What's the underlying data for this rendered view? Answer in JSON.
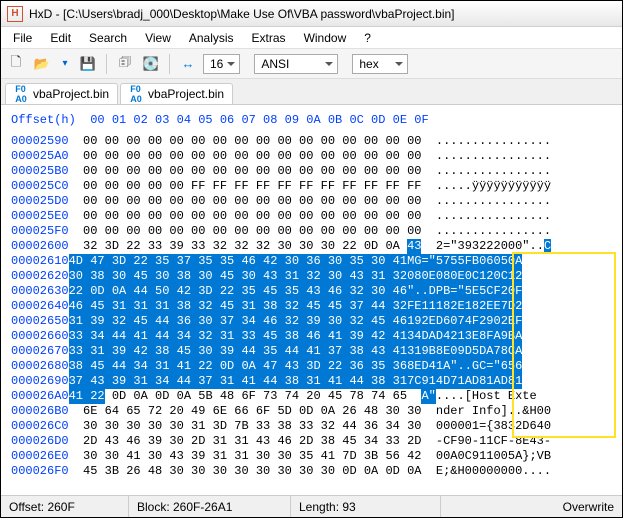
{
  "title": "HxD - [C:\\Users\\bradj_000\\Desktop\\Make Use Of\\VBA password\\vbaProject.bin]",
  "menu": {
    "file": "File",
    "edit": "Edit",
    "search": "Search",
    "view": "View",
    "analysis": "Analysis",
    "extras": "Extras",
    "window": "Window",
    "help": "?"
  },
  "toolbar": {
    "bytes_per_row": "16",
    "encoding": "ANSI",
    "base": "hex"
  },
  "tabs": {
    "tab1": "vbaProject.bin",
    "tab2": "vbaProject.bin"
  },
  "header_label": "Offset(h)",
  "header_cols": "00 01 02 03 04 05 06 07 08 09 0A 0B 0C 0D 0E 0F",
  "rows": [
    {
      "off": "00002590",
      "hex": "00 00 00 00 00 00 00 00 00 00 00 00 00 00 00 00",
      "asc": "................"
    },
    {
      "off": "000025A0",
      "hex": "00 00 00 00 00 00 00 00 00 00 00 00 00 00 00 00",
      "asc": "................"
    },
    {
      "off": "000025B0",
      "hex": "00 00 00 00 00 00 00 00 00 00 00 00 00 00 00 00",
      "asc": "................"
    },
    {
      "off": "000025C0",
      "hex": "00 00 00 00 00 FF FF FF FF FF FF FF FF FF FF FF",
      "asc": ".....ÿÿÿÿÿÿÿÿÿÿÿ"
    },
    {
      "off": "000025D0",
      "hex": "00 00 00 00 00 00 00 00 00 00 00 00 00 00 00 00",
      "asc": "................"
    },
    {
      "off": "000025E0",
      "hex": "00 00 00 00 00 00 00 00 00 00 00 00 00 00 00 00",
      "asc": "................"
    },
    {
      "off": "000025F0",
      "hex": "00 00 00 00 00 00 00 00 00 00 00 00 00 00 00 00",
      "asc": "................"
    },
    {
      "off": "00002600",
      "hex": "32 3D 22 33 39 33 32 32 32 30 30 30 22 0D 0A ",
      "asc": "2=\"393222000\"..",
      "hexsel": "43",
      "ascsel": "C"
    },
    {
      "off": "00002610",
      "hex": "",
      "asc": "",
      "hexsel": "4D 47 3D 22 35 37 35 35 46 42 30 36 30 35 30 41",
      "ascsel": "MG=\"5755FB06050A"
    },
    {
      "off": "00002620",
      "hex": "",
      "asc": "",
      "hexsel": "30 38 30 45 30 38 30 45 30 43 31 32 30 43 31 32",
      "ascsel": "080E080E0C120C12"
    },
    {
      "off": "00002630",
      "hex": "",
      "asc": "",
      "hexsel": "22 0D 0A 44 50 42 3D 22 35 45 35 43 46 32 30 46",
      "ascsel": "\"..DPB=\"5E5CF20F"
    },
    {
      "off": "00002640",
      "hex": "",
      "asc": "",
      "hexsel": "46 45 31 31 31 38 32 45 31 38 32 45 45 37 44 32",
      "ascsel": "FE11182E182EE7D2"
    },
    {
      "off": "00002650",
      "hex": "",
      "asc": "",
      "hexsel": "31 39 32 45 44 36 30 37 34 46 32 39 30 32 45 46",
      "ascsel": "192ED6074F2902EF"
    },
    {
      "off": "00002660",
      "hex": "",
      "asc": "",
      "hexsel": "33 34 44 41 44 34 32 31 33 45 38 46 41 39 42 41",
      "ascsel": "34DAD4213E8FA9BA"
    },
    {
      "off": "00002670",
      "hex": "",
      "asc": "",
      "hexsel": "33 31 39 42 38 45 30 39 44 35 44 41 37 38 43 41",
      "ascsel": "319B8E09D5DA78CA"
    },
    {
      "off": "00002680",
      "hex": "",
      "asc": "",
      "hexsel": "38 45 44 34 31 41 22 0D 0A 47 43 3D 22 36 35 36",
      "ascsel": "8ED41A\"..GC=\"656"
    },
    {
      "off": "00002690",
      "hex": "",
      "asc": "",
      "hexsel": "37 43 39 31 34 44 37 31 41 44 38 31 41 44 38 31",
      "ascsel": "7C914D71AD81AD81"
    },
    {
      "off": "000026A0",
      "hexsel": "41 22",
      "hex": " 0D 0A 0D 0A 5B 48 6F 73 74 20 45 78 74 65",
      "ascsel": "A\"",
      "asc": "....[Host Exte"
    },
    {
      "off": "000026B0",
      "hex": "6E 64 65 72 20 49 6E 66 6F 5D 0D 0A 26 48 30 30",
      "asc": "nder Info]..&H00"
    },
    {
      "off": "000026C0",
      "hex": "30 30 30 30 30 31 3D 7B 33 38 33 32 44 36 34 30",
      "asc": "000001={3832D640"
    },
    {
      "off": "000026D0",
      "hex": "2D 43 46 39 30 2D 31 31 43 46 2D 38 45 34 33 2D",
      "asc": "-CF90-11CF-8E43-"
    },
    {
      "off": "000026E0",
      "hex": "30 30 41 30 43 39 31 31 30 30 35 41 7D 3B 56 42",
      "asc": "00A0C911005A};VB"
    },
    {
      "off": "000026F0",
      "hex": "45 3B 26 48 30 30 30 30 30 30 30 30 0D 0A 0D 0A",
      "asc": "E;&H00000000...."
    }
  ],
  "status": {
    "offset_lbl": "Offset: 260F",
    "block_lbl": "Block: 260F-26A1",
    "length_lbl": "Length: 93",
    "mode": "Overwrite"
  }
}
